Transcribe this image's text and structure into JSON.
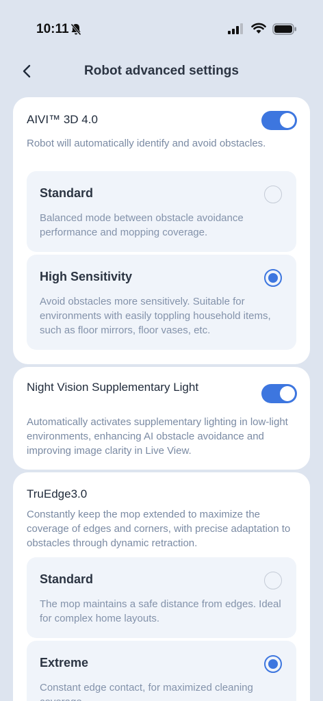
{
  "status_bar": {
    "time": "10:11"
  },
  "header": {
    "title": "Robot advanced settings"
  },
  "aivi": {
    "title": "AIVI™ 3D 4.0",
    "enabled": true,
    "description": "Robot will automatically identify and avoid obstacles.",
    "options": [
      {
        "title": "Standard",
        "description": "Balanced mode between obstacle avoidance performance and mopping coverage.",
        "selected": false
      },
      {
        "title": "High Sensitivity",
        "description": "Avoid obstacles more sensitively. Suitable for environments with easily toppling household items, such as floor mirrors, floor vases, etc.",
        "selected": true
      }
    ]
  },
  "night_vision": {
    "title": "Night Vision Supplementary Light",
    "enabled": true,
    "description": "Automatically activates supplementary lighting in low-light environments, enhancing AI obstacle avoidance and improving image clarity in Live View."
  },
  "truedge": {
    "title": "TruEdge3.0",
    "description": "Constantly keep the mop extended to maximize the coverage of edges and corners, with precise adaptation to obstacles through dynamic retraction.",
    "options": [
      {
        "title": "Standard",
        "description": "The mop maintains a safe distance from edges. Ideal for complex home layouts.",
        "selected": false
      },
      {
        "title": "Extreme",
        "description": "Constant edge contact, for maximized cleaning coverage.",
        "selected": true
      }
    ]
  },
  "colors": {
    "accent": "#3d76df",
    "background": "#dde4ef",
    "option_bg": "#f0f4fa"
  }
}
